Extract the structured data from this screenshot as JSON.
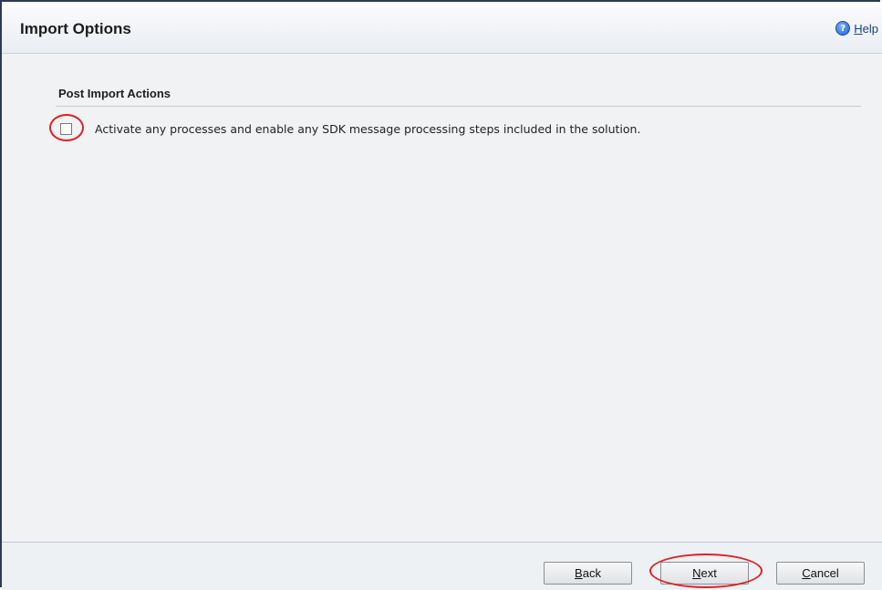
{
  "dialog": {
    "title": "Import Options",
    "help_label_accel": "H",
    "help_label_rest": "elp"
  },
  "section": {
    "title": "Post Import Actions",
    "checkbox_label": "Activate any processes and enable any SDK message processing steps included in the solution.",
    "checkbox_checked": false
  },
  "buttons": {
    "back": {
      "accel": "B",
      "rest": "ack"
    },
    "next": {
      "accel": "N",
      "rest": "ext"
    },
    "cancel": {
      "accel": "C",
      "rest": "ancel"
    }
  },
  "annotation_color": "#e02020"
}
